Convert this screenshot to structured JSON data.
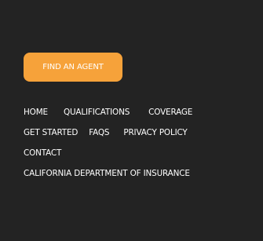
{
  "cta": {
    "label": "FIND AN AGENT",
    "color": "#f6a23a"
  },
  "footer_nav": {
    "home": "HOME",
    "qualifications": "QUALIFICATIONS",
    "coverage": "COVERAGE",
    "get_started": "GET STARTED",
    "faqs": "FAQS",
    "privacy_policy": "PRIVACY POLICY",
    "contact": "CONTACT",
    "california_department": "CALIFORNIA DEPARTMENT OF INSURANCE"
  },
  "colors": {
    "background": "#232323",
    "text": "#ffffff"
  }
}
